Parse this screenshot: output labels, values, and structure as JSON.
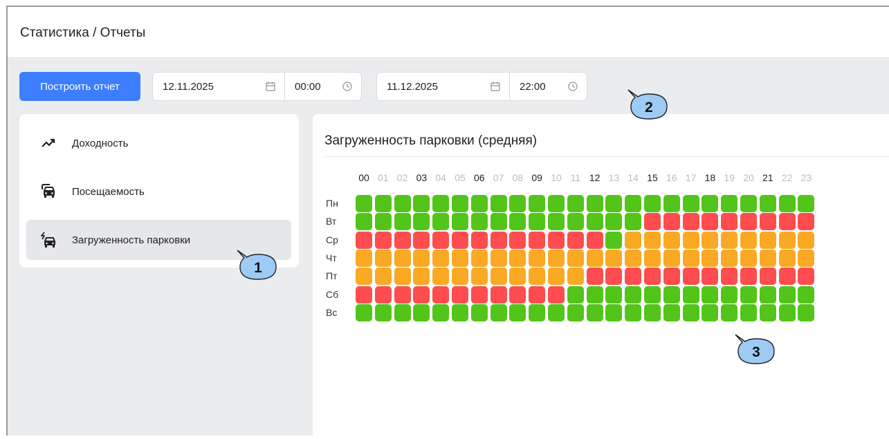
{
  "header": {
    "breadcrumb": "Статистика / Отчеты"
  },
  "toolbar": {
    "build_label": "Построить отчет",
    "start_date": "12.11.2025",
    "start_time": "00:00",
    "end_date": "11.12.2025",
    "end_time": "22:00"
  },
  "menu": {
    "items": [
      {
        "label": "Доходность",
        "icon": "trend-up-icon",
        "active": false
      },
      {
        "label": "Посещаемость",
        "icon": "car-icon",
        "active": false
      },
      {
        "label": "Загруженность парковки",
        "icon": "car-charging-icon",
        "active": true
      }
    ]
  },
  "report": {
    "title": "Загруженность парковки (средняя)",
    "hours": [
      "00",
      "01",
      "02",
      "03",
      "04",
      "05",
      "06",
      "07",
      "08",
      "09",
      "10",
      "11",
      "12",
      "13",
      "14",
      "15",
      "16",
      "17",
      "18",
      "19",
      "20",
      "21",
      "22",
      "23"
    ],
    "major_hours": [
      "00",
      "03",
      "06",
      "09",
      "12",
      "15",
      "18",
      "21"
    ],
    "days": [
      "Пн",
      "Вт",
      "Ср",
      "Чт",
      "Пт",
      "Сб",
      "Вс"
    ],
    "levels": {
      "g": "#52c41a",
      "r": "#ff4d4f",
      "o": "#faa925"
    },
    "grid": [
      "gggggggggggggggggggggggg",
      "gggggggggggggggrrrrrrrrr",
      "rrrrrrrrrrrrrgoooooooooo",
      "oooooooooooooooooooooooo",
      "oooooooooooorrrrrrrrrrrr",
      "rrrrrrrrrrrggggggggggggg",
      "gggggggggggggggggggggggg"
    ]
  },
  "callouts": [
    "1",
    "2",
    "3"
  ],
  "colors": {
    "accent": "#3d7dff",
    "callout_fill": "#9ecbf5"
  }
}
